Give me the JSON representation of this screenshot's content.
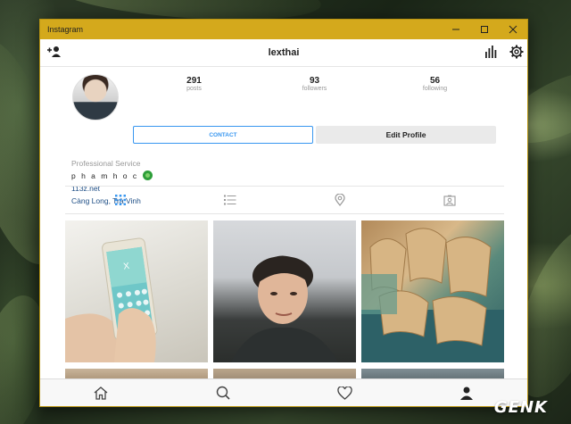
{
  "window": {
    "title": "Instagram"
  },
  "appbar": {
    "username": "lexthai"
  },
  "stats": [
    {
      "num": "291",
      "label": "posts"
    },
    {
      "num": "93",
      "label": "followers"
    },
    {
      "num": "56",
      "label": "following"
    }
  ],
  "buttons": {
    "contact": "CONTACT",
    "edit_profile": "Edit Profile"
  },
  "bio": {
    "category": "Professional Service",
    "name": "p h a m h o c",
    "link": "113z.net",
    "location": "Càng Long, Trà Vinh"
  },
  "colors": {
    "titlebar": "#d4a91c",
    "accent": "#3897f0",
    "link": "#1f4f86"
  },
  "icons": {
    "appbar_left": "add-user-icon",
    "appbar_right": [
      "insights-icon",
      "settings-gear-icon"
    ],
    "tabs": [
      "grid-icon",
      "list-icon",
      "location-pin-icon",
      "tagged-person-icon"
    ],
    "bottom": [
      "home-icon",
      "search-icon",
      "heart-icon",
      "profile-icon"
    ]
  },
  "watermark": "GENK"
}
